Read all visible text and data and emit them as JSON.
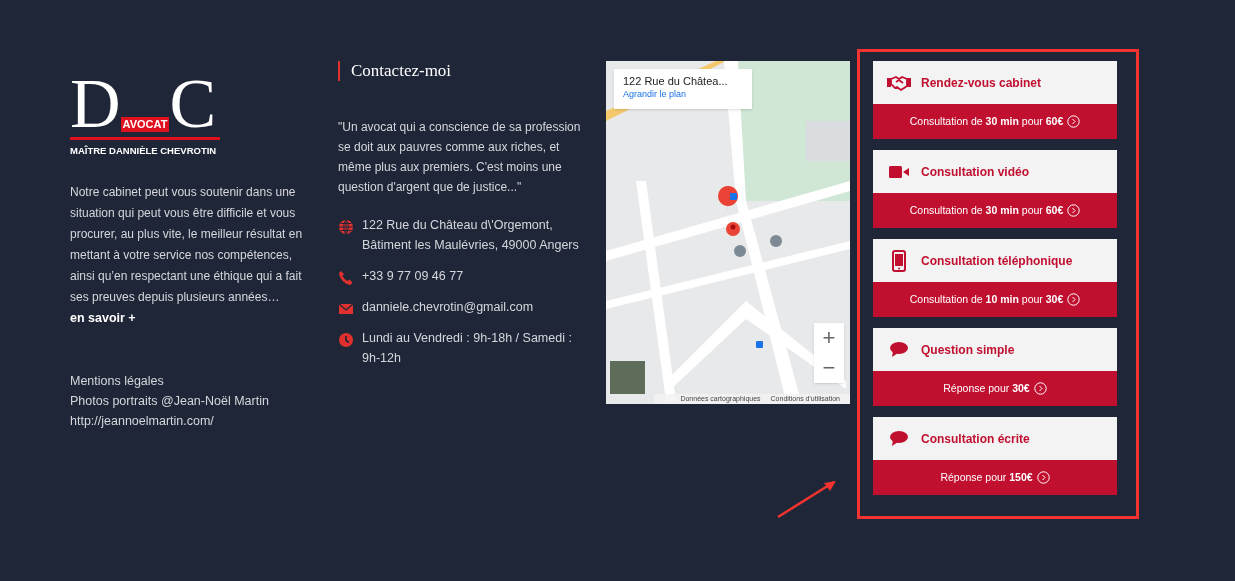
{
  "logo": {
    "letter_left": "D",
    "letter_right": "C",
    "badge": "AVOCAT",
    "name": "MAÎTRE DANNIÈLE CHEVROTIN"
  },
  "about": {
    "text": "Notre cabinet peut vous soutenir dans une situation qui peut vous être difficile et vous procurer, au plus vite, le meilleur résultat en mettant à votre service nos compétences, ainsi qu’en respectant une éthique qui a fait ses preuves depuis plusieurs années…",
    "link": "en savoir +"
  },
  "footer_lines": [
    "Mentions légales",
    "Photos portraits @Jean-Noël Martin http://jeannoelmartin.com/"
  ],
  "contact": {
    "title": "Contactez-moi",
    "quote": "\"Un avocat qui a conscience de sa profession se doit aux pauvres comme aux riches, et même plus aux premiers. C'est moins une question d'argent que de justice...\"",
    "items": [
      {
        "kind": "address",
        "text": "122 Rue du Château d\\'Orgemont, Bâtiment les Maulévries, 49000 Angers"
      },
      {
        "kind": "phone",
        "text": "+33 9 77 09 46 77"
      },
      {
        "kind": "email",
        "text": "danniele.chevrotin@gmail.com"
      },
      {
        "kind": "hours",
        "text": "Lundi au Vendredi : 9h-18h / Samedi : 9h-12h"
      }
    ]
  },
  "map": {
    "kind": "picture",
    "place_title": "122 Rue du Châtea...",
    "enlarge_link": "Agrandir le plan",
    "zoom_in": "+",
    "zoom_out": "−",
    "attribution": [
      "Données cartographiques",
      "Conditions d'utilisation"
    ]
  },
  "services": [
    {
      "kind": "handshake",
      "title": "Rendez-vous cabinet",
      "offer": "Consultation de **30 min** pour **60€**"
    },
    {
      "kind": "video",
      "title": "Consultation vidéo",
      "offer": "Consultation de **30 min** pour **60€**"
    },
    {
      "kind": "phone",
      "title": "Consultation téléphonique",
      "offer": "Consultation de **10 min** pour **30€**"
    },
    {
      "kind": "chat",
      "title": "Question simple",
      "offer": "Réponse pour **30€**"
    },
    {
      "kind": "chat",
      "title": "Consultation écrite",
      "offer": "Réponse pour **150€**"
    }
  ]
}
